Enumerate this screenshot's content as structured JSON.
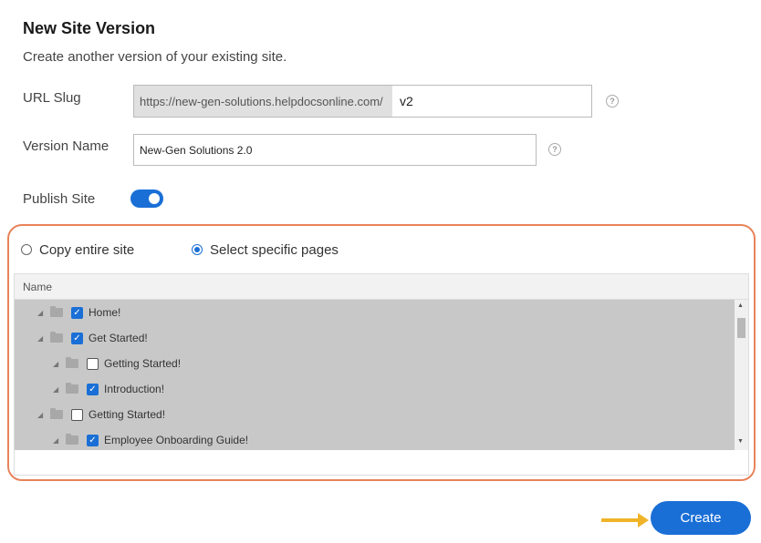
{
  "header": {
    "title": "New Site Version",
    "subtitle": "Create another version of your existing site."
  },
  "url_slug": {
    "label": "URL Slug",
    "prefix": "https://new-gen-solutions.helpdocsonline.com/",
    "value": "v2"
  },
  "version_name": {
    "label": "Version Name",
    "value": "New-Gen Solutions 2.0"
  },
  "publish": {
    "label": "Publish Site",
    "enabled": true
  },
  "copy_options": {
    "option_entire": "Copy entire site",
    "option_specific": "Select specific pages",
    "selected": "specific"
  },
  "tree": {
    "column_header": "Name",
    "rows": [
      {
        "label": "Home!",
        "checked": true,
        "depth": 0
      },
      {
        "label": "Get Started!",
        "checked": true,
        "depth": 0
      },
      {
        "label": "Getting Started!",
        "checked": false,
        "depth": 1
      },
      {
        "label": "Introduction!",
        "checked": true,
        "depth": 1
      },
      {
        "label": "Getting Started!",
        "checked": false,
        "depth": 0
      },
      {
        "label": "Employee Onboarding Guide!",
        "checked": true,
        "depth": 1
      }
    ]
  },
  "actions": {
    "create_label": "Create"
  },
  "colors": {
    "accent": "#1a6fd6",
    "highlight_border": "#e8835a",
    "arrow": "#f0b429"
  }
}
